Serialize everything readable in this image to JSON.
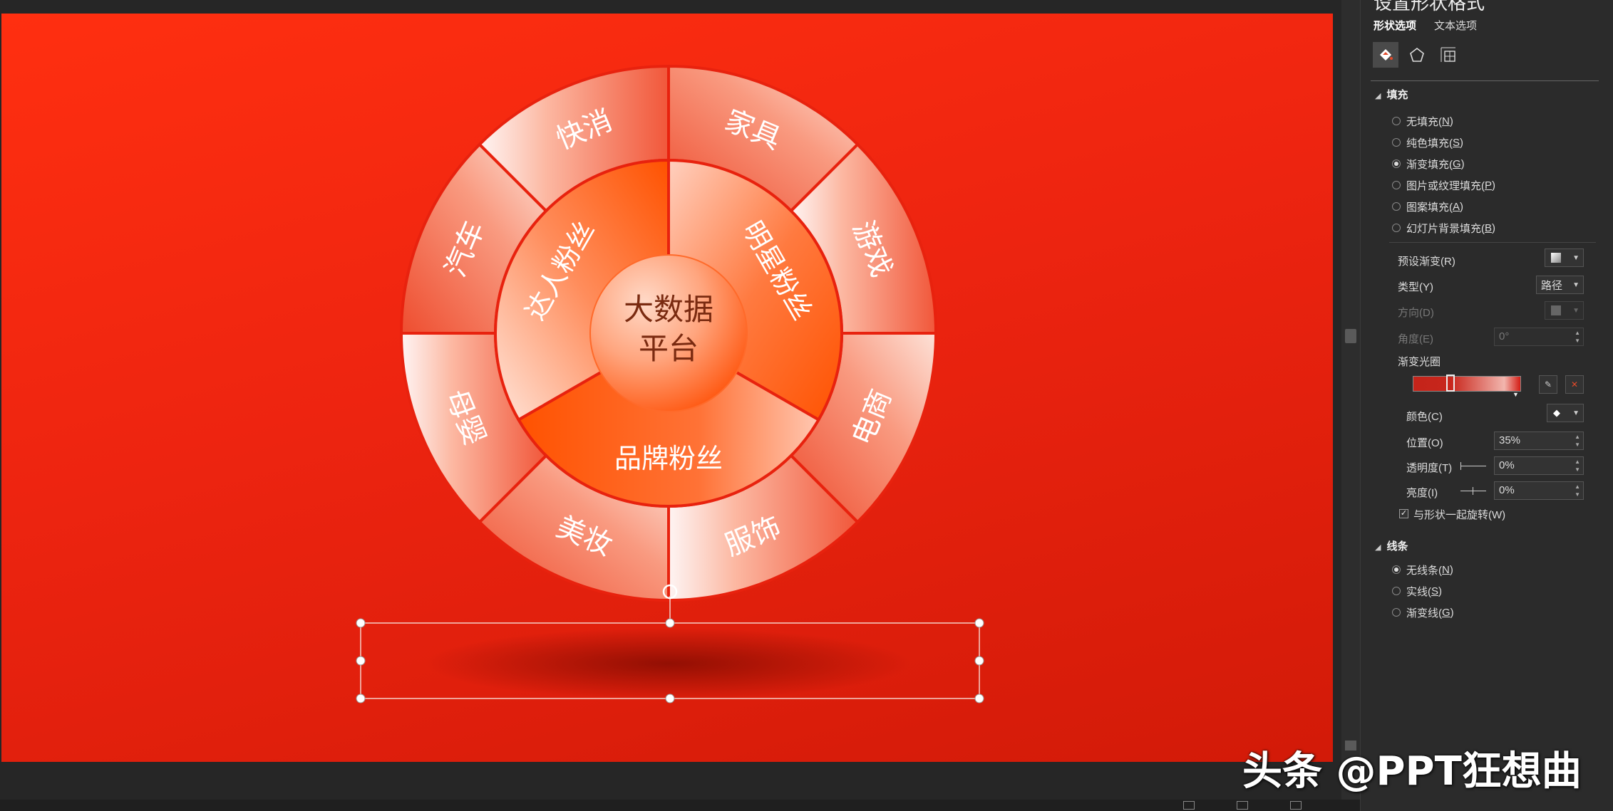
{
  "slide": {
    "center_line1": "大数据",
    "center_line2": "平台",
    "inner_segments": [
      "明星粉丝",
      "品牌粉丝",
      "达人粉丝"
    ],
    "outer_segments": [
      "家具",
      "游戏",
      "电商",
      "服饰",
      "美妆",
      "母婴",
      "汽车",
      "快消"
    ]
  },
  "pane": {
    "title": "设置形状格式",
    "tabs": [
      "形状选项",
      "文本选项"
    ],
    "icons": [
      "fill-line-icon",
      "effects-pentagon-icon",
      "size-properties-icon"
    ],
    "fill": {
      "heading": "填充",
      "options": [
        {
          "label": "无填充(",
          "key": "N",
          "checked": false
        },
        {
          "label": "纯色填充(",
          "key": "S",
          "checked": false
        },
        {
          "label": "渐变填充(",
          "key": "G",
          "checked": true
        },
        {
          "label": "图片或纹理填充(",
          "key": "P",
          "checked": false
        },
        {
          "label": "图案填充(",
          "key": "A",
          "checked": false
        },
        {
          "label": "幻灯片背景填充(",
          "key": "B",
          "checked": false
        }
      ],
      "preset_label": "预设渐变(R)",
      "type_label": "类型(Y)",
      "type_value": "路径",
      "direction_label": "方向(D)",
      "angle_label": "角度(E)",
      "angle_value": "0°",
      "stops_label": "渐变光圈",
      "color_label": "颜色(C)",
      "position_label": "位置(O)",
      "position_value": "35%",
      "transparency_label": "透明度(T)",
      "transparency_value": "0%",
      "brightness_label": "亮度(I)",
      "brightness_value": "0%",
      "rotate_label": "与形状一起旋转(W)",
      "rotate_checked": true
    },
    "line": {
      "heading": "线条",
      "options": [
        {
          "label": "无线条(",
          "key": "N",
          "checked": true
        },
        {
          "label": "实线(",
          "key": "S",
          "checked": false
        },
        {
          "label": "渐变线(",
          "key": "G",
          "checked": false
        }
      ]
    }
  },
  "watermark": "头条 @PPT狂想曲",
  "colors": {
    "slide_bg": "#e8220e",
    "accent_orange": "#ff5200",
    "pane_bg": "#2b2b2b"
  }
}
